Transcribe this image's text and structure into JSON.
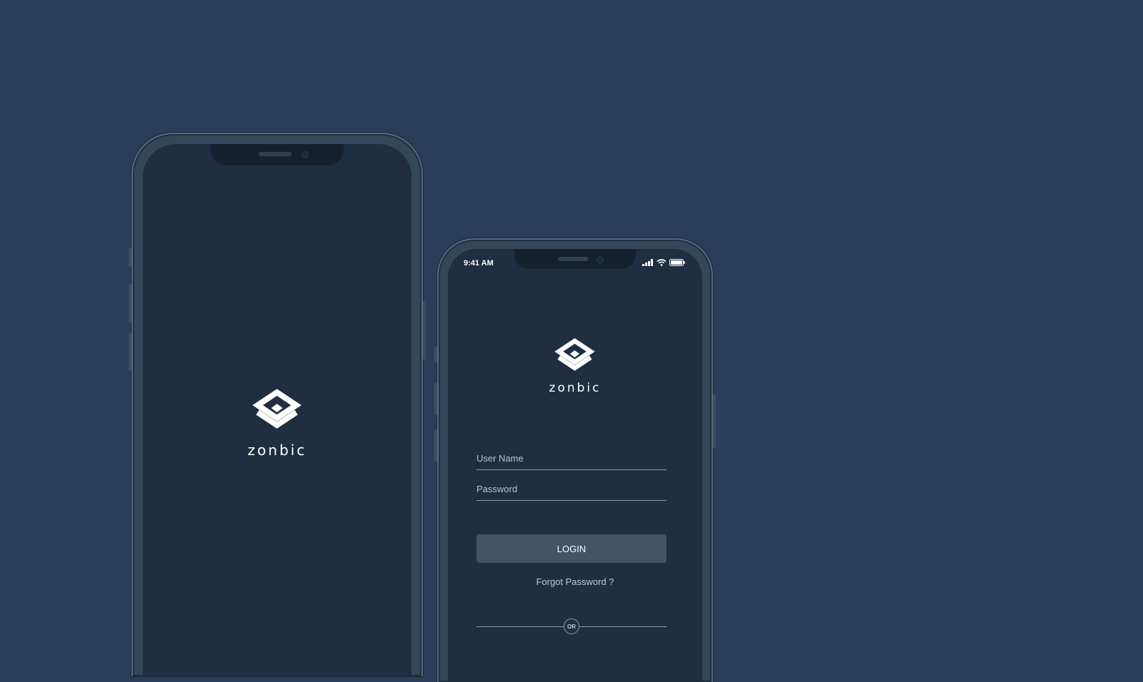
{
  "splash": {
    "brand": "zonbic",
    "logo_icon": "zonbic-logo-icon"
  },
  "login": {
    "status_time": "9:41 AM",
    "status_icons": [
      "signal-icon",
      "wifi-icon",
      "battery-icon"
    ],
    "brand": "zonbic",
    "logo_icon": "zonbic-logo-icon",
    "username_placeholder": "User Name",
    "password_placeholder": "Password",
    "login_label": "LOGIN",
    "forgot_label": "Forgot Password ?",
    "or_label": "OR"
  },
  "colors": {
    "background": "#283e5a",
    "screen": "#1f2e41",
    "button": "#425466",
    "text": "#ffffff"
  }
}
